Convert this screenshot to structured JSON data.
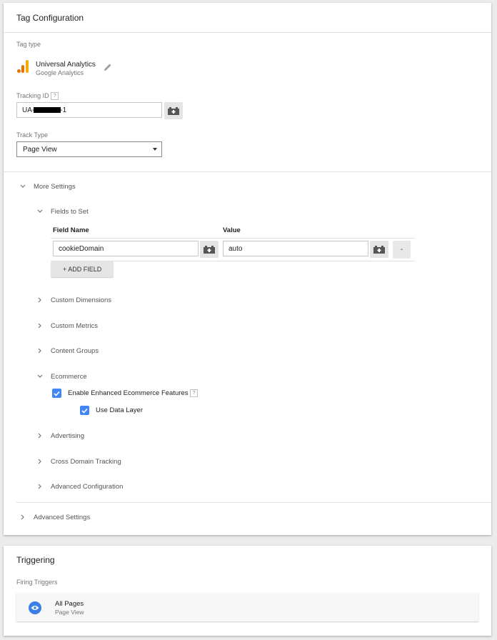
{
  "tag_config": {
    "title": "Tag Configuration",
    "tag_type_label": "Tag type",
    "tag_type_name": "Universal Analytics",
    "tag_type_vendor": "Google Analytics",
    "tracking_id_label": "Tracking ID",
    "tracking_id_help": "?",
    "tracking_id_prefix": "UA-",
    "tracking_id_suffix": "-1",
    "track_type_label": "Track Type",
    "track_type_value": "Page View",
    "more_settings": "More Settings",
    "fields_to_set": "Fields to Set",
    "field_name_header": "Field Name",
    "value_header": "Value",
    "field_name_value": "cookieDomain",
    "field_value_value": "auto",
    "remove_label": "-",
    "add_field": "+ ADD FIELD",
    "custom_dimensions": "Custom Dimensions",
    "custom_metrics": "Custom Metrics",
    "content_groups": "Content Groups",
    "ecommerce": "Ecommerce",
    "enable_ecommerce": "Enable Enhanced Ecommerce Features",
    "enable_ecommerce_help": "?",
    "use_data_layer": "Use Data Layer",
    "advertising": "Advertising",
    "cross_domain": "Cross Domain Tracking",
    "advanced_configuration": "Advanced Configuration",
    "advanced_settings": "Advanced Settings"
  },
  "triggering": {
    "title": "Triggering",
    "firing_label": "Firing Triggers",
    "trigger_name": "All Pages",
    "trigger_type": "Page View"
  },
  "colors": {
    "accent_blue": "#4285f4",
    "ga_orange": "#f9ab00",
    "ga_dark_orange": "#e37400"
  }
}
